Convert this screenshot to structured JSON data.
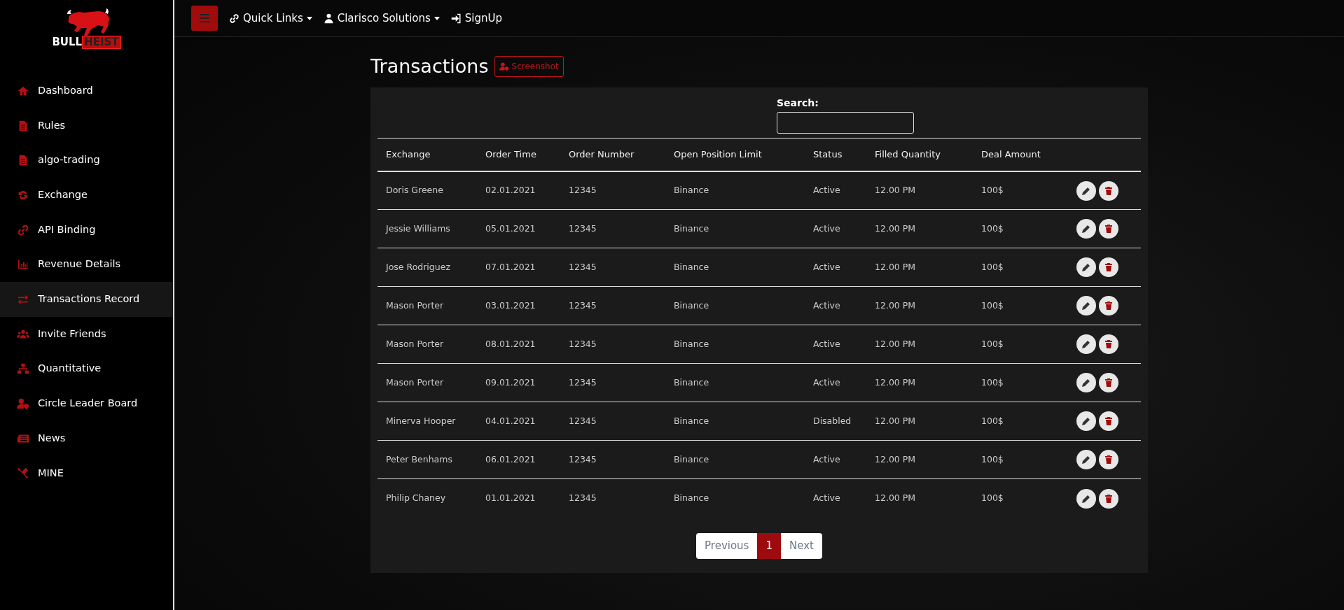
{
  "logo": {
    "word_1": "BULL",
    "word_2": "HEIST"
  },
  "sidebar": {
    "items": [
      {
        "label": "Dashboard",
        "kind": "home",
        "selected": false
      },
      {
        "label": "Rules",
        "kind": "file",
        "selected": false
      },
      {
        "label": "algo-trading",
        "kind": "file",
        "selected": false
      },
      {
        "label": "Exchange",
        "kind": "sync",
        "selected": false
      },
      {
        "label": "API Binding",
        "kind": "link",
        "selected": false
      },
      {
        "label": "Revenue Details",
        "kind": "chart",
        "selected": false
      },
      {
        "label": "Transactions Record",
        "kind": "swap",
        "selected": true
      },
      {
        "label": "Invite Friends",
        "kind": "users",
        "selected": false
      },
      {
        "label": "Quantitative",
        "kind": "network",
        "selected": false
      },
      {
        "label": "Circle Leader Board",
        "kind": "usershield",
        "selected": false
      },
      {
        "label": "News",
        "kind": "news",
        "selected": false
      },
      {
        "label": "MINE",
        "kind": "tools",
        "selected": false
      }
    ]
  },
  "topbar": {
    "links": [
      {
        "label": "Quick Links",
        "kind": "link",
        "dropdown": true
      },
      {
        "label": "Clarisco Solutions",
        "kind": "user",
        "dropdown": true
      },
      {
        "label": "SignUp",
        "kind": "signin",
        "dropdown": false
      }
    ]
  },
  "page": {
    "title": "Transactions",
    "screenshot_button": "Screenshot"
  },
  "search": {
    "label": "Search:"
  },
  "table": {
    "columns": [
      "Exchange",
      "Order Time",
      "Order Number",
      "Open Position Limit",
      "Status",
      "Filled Quantity",
      "Deal Amount"
    ],
    "rows": [
      [
        "Doris Greene",
        "02.01.2021",
        "12345",
        "Binance",
        "Active",
        "12.00 PM",
        "100$"
      ],
      [
        "Jessie Williams",
        "05.01.2021",
        "12345",
        "Binance",
        "Active",
        "12.00 PM",
        "100$"
      ],
      [
        "Jose Rodriguez",
        "07.01.2021",
        "12345",
        "Binance",
        "Active",
        "12.00 PM",
        "100$"
      ],
      [
        "Mason Porter",
        "03.01.2021",
        "12345",
        "Binance",
        "Active",
        "12.00 PM",
        "100$"
      ],
      [
        "Mason Porter",
        "08.01.2021",
        "12345",
        "Binance",
        "Active",
        "12.00 PM",
        "100$"
      ],
      [
        "Mason Porter",
        "09.01.2021",
        "12345",
        "Binance",
        "Active",
        "12.00 PM",
        "100$"
      ],
      [
        "Minerva Hooper",
        "04.01.2021",
        "12345",
        "Binance",
        "Disabled",
        "12.00 PM",
        "100$"
      ],
      [
        "Peter Benhams",
        "06.01.2021",
        "12345",
        "Binance",
        "Active",
        "12.00 PM",
        "100$"
      ],
      [
        "Philip Chaney",
        "01.01.2021",
        "12345",
        "Binance",
        "Active",
        "12.00 PM",
        "100$"
      ]
    ]
  },
  "pagination": {
    "previous": "Previous",
    "pages": [
      {
        "label": "1",
        "selected": true
      }
    ],
    "next": "Next"
  }
}
